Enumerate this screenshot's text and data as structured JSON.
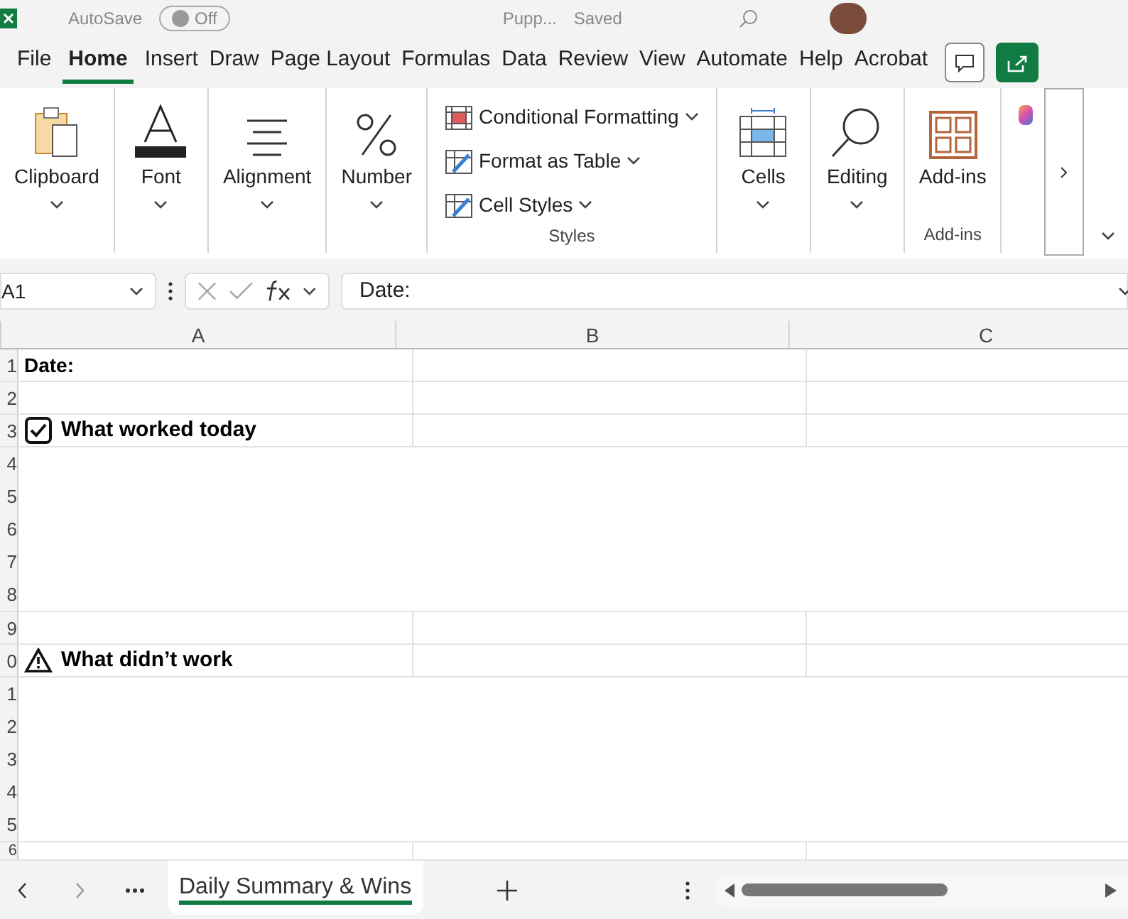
{
  "title_bar": {
    "autosave_label": "AutoSave",
    "autosave_toggle": {
      "label": "Off",
      "on": false
    },
    "file_name": "Pupp...",
    "save_status": "Saved"
  },
  "menu_tabs": [
    {
      "label": "File",
      "selected": false
    },
    {
      "label": "Home",
      "selected": true
    },
    {
      "label": "Insert",
      "selected": false
    },
    {
      "label": "Draw",
      "selected": false
    },
    {
      "label": "Page Layout",
      "selected": false
    },
    {
      "label": "Formulas",
      "selected": false
    },
    {
      "label": "Data",
      "selected": false
    },
    {
      "label": "Review",
      "selected": false
    },
    {
      "label": "View",
      "selected": false
    },
    {
      "label": "Automate",
      "selected": false
    },
    {
      "label": "Help",
      "selected": false
    },
    {
      "label": "Acrobat",
      "selected": false
    }
  ],
  "ribbon": {
    "groups": [
      {
        "kind": "clipboard",
        "label": "Clipboard"
      },
      {
        "kind": "font",
        "label": "Font"
      },
      {
        "kind": "alignment",
        "label": "Alignment"
      },
      {
        "kind": "number",
        "label": "Number"
      },
      {
        "kind": "styles",
        "group_label": "Styles",
        "items": [
          "Conditional Formatting",
          "Format as Table",
          "Cell Styles"
        ]
      },
      {
        "kind": "cells",
        "label": "Cells"
      },
      {
        "kind": "editing",
        "label": "Editing"
      },
      {
        "kind": "addins",
        "label": "Add-ins",
        "group_label": "Add-ins"
      }
    ]
  },
  "formula_bar": {
    "name_box": "A1",
    "formula": "Date:"
  },
  "sheet": {
    "columns": [
      "A",
      "B",
      "C"
    ],
    "rows": [
      {
        "kind": "text",
        "number": "1",
        "text": "Date:"
      },
      {
        "kind": "blank",
        "number": "2"
      },
      {
        "kind": "check-heading",
        "number": "3",
        "text": "What worked today"
      },
      {
        "kind": "merged",
        "numbers": [
          "4",
          "5",
          "6",
          "7",
          "8"
        ]
      },
      {
        "kind": "blank",
        "number": "9"
      },
      {
        "kind": "warning-heading",
        "number": "0",
        "text": "What didn’t work"
      },
      {
        "kind": "merged",
        "numbers": [
          "1",
          "2",
          "3",
          "4",
          "5"
        ]
      },
      {
        "kind": "blank",
        "number": "6"
      }
    ]
  },
  "sheet_tabs": [
    {
      "label": "Daily Summary & Wins",
      "selected": true
    }
  ]
}
